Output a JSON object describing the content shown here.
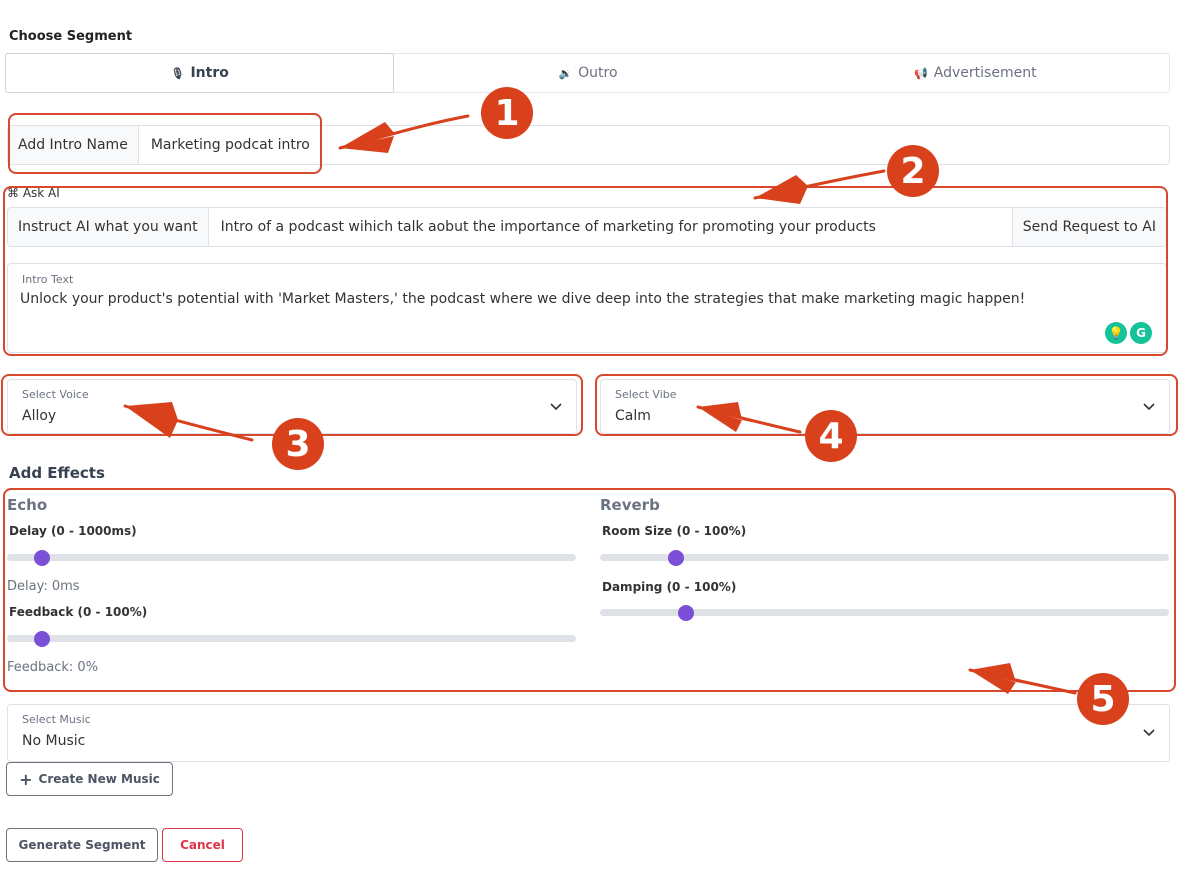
{
  "segment": {
    "label": "Choose Segment",
    "tabs": [
      {
        "label": "Intro",
        "icon": "microphone-icon",
        "active": true
      },
      {
        "label": "Outro",
        "icon": "speaker-icon",
        "active": false
      },
      {
        "label": "Advertisement",
        "icon": "megaphone-icon",
        "active": false
      }
    ]
  },
  "name_field": {
    "label": "Add Intro Name",
    "value": "Marketing podcat intro"
  },
  "ask_ai": {
    "label": "⌘ Ask AI",
    "prefix": "Instruct AI what you want",
    "value": "Intro of a podcast wihich talk aobut the importance of marketing for promoting your products",
    "button": "Send Request to AI"
  },
  "intro_text": {
    "label": "Intro Text",
    "value": "Unlock your product's potential with 'Market Masters,' the podcast where we dive deep into the strategies that make marketing magic happen!"
  },
  "voice": {
    "label": "Select Voice",
    "value": "Alloy"
  },
  "vibe": {
    "label": "Select Vibe",
    "value": "Calm"
  },
  "effects": {
    "title": "Add Effects",
    "echo": {
      "title": "Echo",
      "delay_label": "Delay (0 - 1000ms)",
      "delay_value": 0,
      "delay_text": "Delay: 0ms",
      "feedback_label": "Feedback (0 - 100%)",
      "feedback_value": 0,
      "feedback_text": "Feedback: 0%"
    },
    "reverb": {
      "title": "Reverb",
      "room_label": "Room Size (0 - 100%)",
      "room_value": 8,
      "damping_label": "Damping (0 - 100%)",
      "damping_value": 10
    }
  },
  "music": {
    "label": "Select Music",
    "value": "No Music",
    "create_button": "Create New Music"
  },
  "actions": {
    "generate": "Generate Segment",
    "cancel": "Cancel"
  },
  "annotations": [
    "1",
    "2",
    "3",
    "4",
    "5"
  ],
  "colors": {
    "accent": "#7b4fd6",
    "annotation": "#d8411c",
    "cancel": "#dc3545"
  }
}
